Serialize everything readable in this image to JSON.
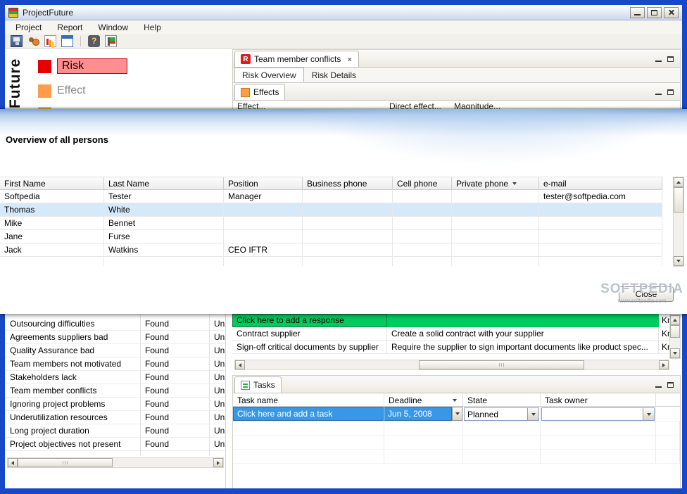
{
  "titlebar": {
    "title": "ProjectFuture"
  },
  "menu": {
    "items": [
      "Project",
      "Report",
      "Window",
      "Help"
    ]
  },
  "toolbar": {
    "icons": [
      "save-icon",
      "team-icon",
      "chart-icon",
      "report-icon",
      "help-icon",
      "run-icon"
    ]
  },
  "colors": {
    "window_border": "#1748c8",
    "risk_red": "#e60000",
    "risk_highlight": "#ff8f8f",
    "effect_orange": "#ff9e4a",
    "add_response_green": "#00cb5e",
    "add_task_blue": "#3898e8",
    "selected_person_row": "#d6e9f9"
  },
  "legend": {
    "vertical_label": "Future",
    "items": [
      {
        "label": "Risk",
        "color": "#e60000",
        "selected": true
      },
      {
        "label": "Effect",
        "color": "#ff9e4a",
        "selected": false
      }
    ]
  },
  "conflicts_view": {
    "icon_letter": "R",
    "tab_label": "Team member conflicts",
    "subtabs": [
      "Risk Overview",
      "Risk Details"
    ]
  },
  "effects_view": {
    "tab_label": "Effects",
    "columns": [
      "Effect...",
      "Direct effect...",
      "Magnitude..."
    ]
  },
  "persons_dialog": {
    "title": "Overview of all persons",
    "columns": [
      "First Name",
      "Last Name",
      "Position",
      "Business phone",
      "Cell phone",
      "Private phone",
      "e-mail"
    ],
    "sorted_column": "Private phone",
    "rows": [
      [
        "Softpedia",
        "Tester",
        "Manager",
        "",
        "",
        "",
        "tester@softpedia.com"
      ],
      [
        "Thomas",
        "White",
        "",
        "",
        "",
        "",
        ""
      ],
      [
        "Mike",
        "Bennet",
        "",
        "",
        "",
        "",
        ""
      ],
      [
        "Jane",
        "Furse",
        "",
        "",
        "",
        "",
        ""
      ],
      [
        "Jack",
        "Watkins",
        "CEO IFTR",
        "",
        "",
        "",
        ""
      ]
    ],
    "selected_row_index": 1,
    "close_label": "Close"
  },
  "watermark": {
    "text": "SOFTPEDIA",
    "subtext": "www.softpedia.com"
  },
  "risk_list": {
    "rows": [
      {
        "name": "Outsourcing difficulties",
        "status": "Found",
        "knowledge": "Unkno"
      },
      {
        "name": "Agreements suppliers bad",
        "status": "Found",
        "knowledge": "Unkno"
      },
      {
        "name": "Quality Assurance bad",
        "status": "Found",
        "knowledge": "Unkno"
      },
      {
        "name": "Team members not motivated",
        "status": "Found",
        "knowledge": "Unkno"
      },
      {
        "name": "Stakeholders lack",
        "status": "Found",
        "knowledge": "Unkno"
      },
      {
        "name": "Team member conflicts",
        "status": "Found",
        "knowledge": "Unkno"
      },
      {
        "name": "Ignoring project problems",
        "status": "Found",
        "knowledge": "Unkno"
      },
      {
        "name": "Underutilization resources",
        "status": "Found",
        "knowledge": "Unkno"
      },
      {
        "name": "Long project duration",
        "status": "Found",
        "knowledge": "Unkno"
      },
      {
        "name": "Project objectives not present",
        "status": "Found",
        "knowledge": "Unkno"
      }
    ]
  },
  "responses": {
    "add_label": "Click here to add a response",
    "add_extra": "Know",
    "rows": [
      {
        "name": "Contract supplier",
        "description": "Create a solid contract with your supplier",
        "extra": "Know"
      },
      {
        "name": "Sign-off critical documents by supplier",
        "description": "Require the supplier to sign important documents like product spec...",
        "extra": "Know"
      }
    ]
  },
  "tasks": {
    "tab_label": "Tasks",
    "columns": [
      "Task name",
      "Deadline",
      "State",
      "Task owner"
    ],
    "new_task": {
      "name": "Click here and add a task",
      "deadline": "Jun 5, 2008",
      "state": "Planned",
      "owner": ""
    }
  }
}
